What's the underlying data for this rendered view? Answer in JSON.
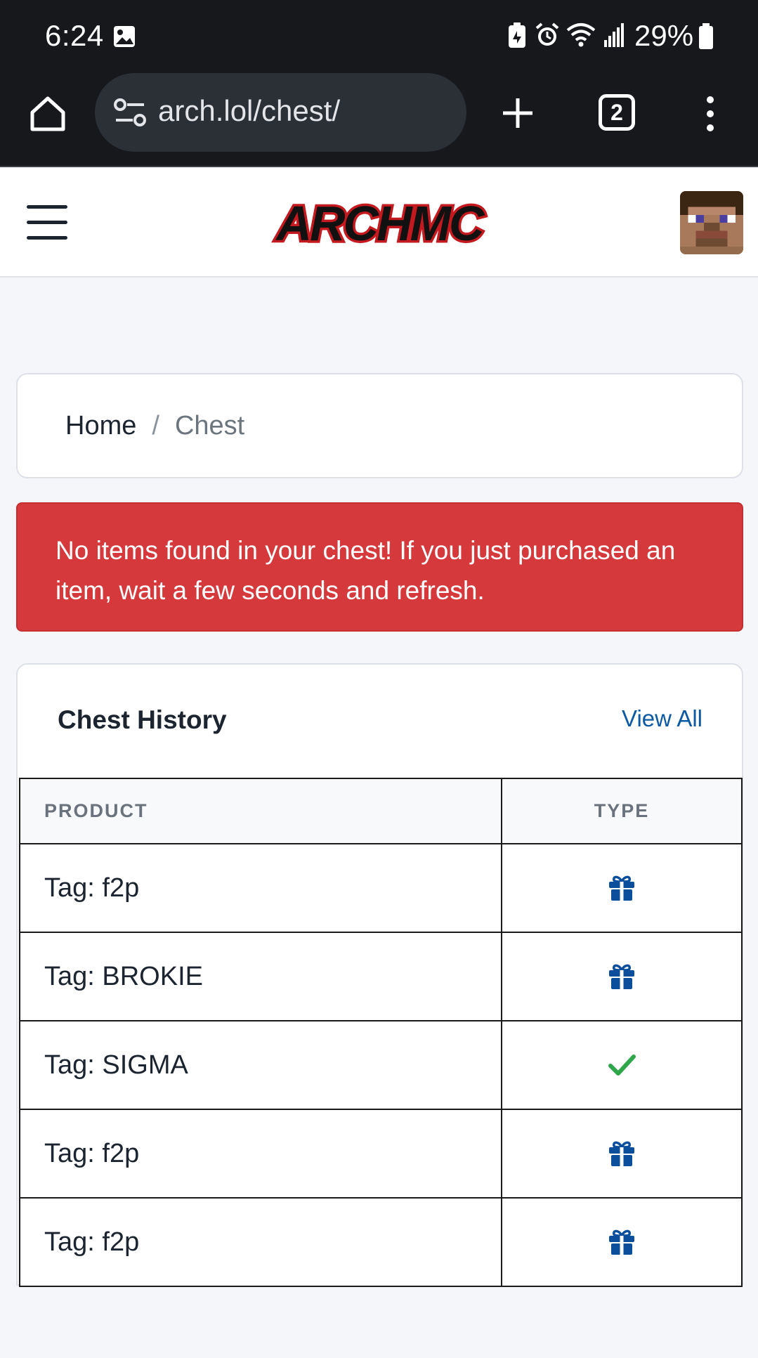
{
  "status_bar": {
    "time": "6:24",
    "battery": "29%",
    "icons": [
      "image-icon",
      "battery-saver-icon",
      "alarm-icon",
      "wifi-icon",
      "signal-icon",
      "battery-icon"
    ]
  },
  "browser": {
    "url": "arch.lol/chest/",
    "tab_count": "2"
  },
  "header": {
    "logo_text": "ARCHMC"
  },
  "breadcrumb": {
    "home": "Home",
    "separator": "/",
    "current": "Chest"
  },
  "alert": {
    "message": "No items found in your chest! If you just purchased an item, wait a few seconds and refresh."
  },
  "history": {
    "title": "Chest History",
    "view_all": "View All",
    "columns": [
      "PRODUCT",
      "TYPE"
    ],
    "rows": [
      {
        "product": "Tag: f2p",
        "type": "gift-icon"
      },
      {
        "product": "Tag: BROKIE",
        "type": "gift-icon"
      },
      {
        "product": "Tag: SIGMA",
        "type": "check-icon"
      },
      {
        "product": "Tag: f2p",
        "type": "gift-icon"
      },
      {
        "product": "Tag: f2p",
        "type": "gift-icon"
      }
    ]
  },
  "colors": {
    "alert_red": "#d6393b",
    "link_blue": "#0b5aa3",
    "gift_blue": "#0b4f9c",
    "check_green": "#2fa64a",
    "browser_dark": "#16181c"
  }
}
